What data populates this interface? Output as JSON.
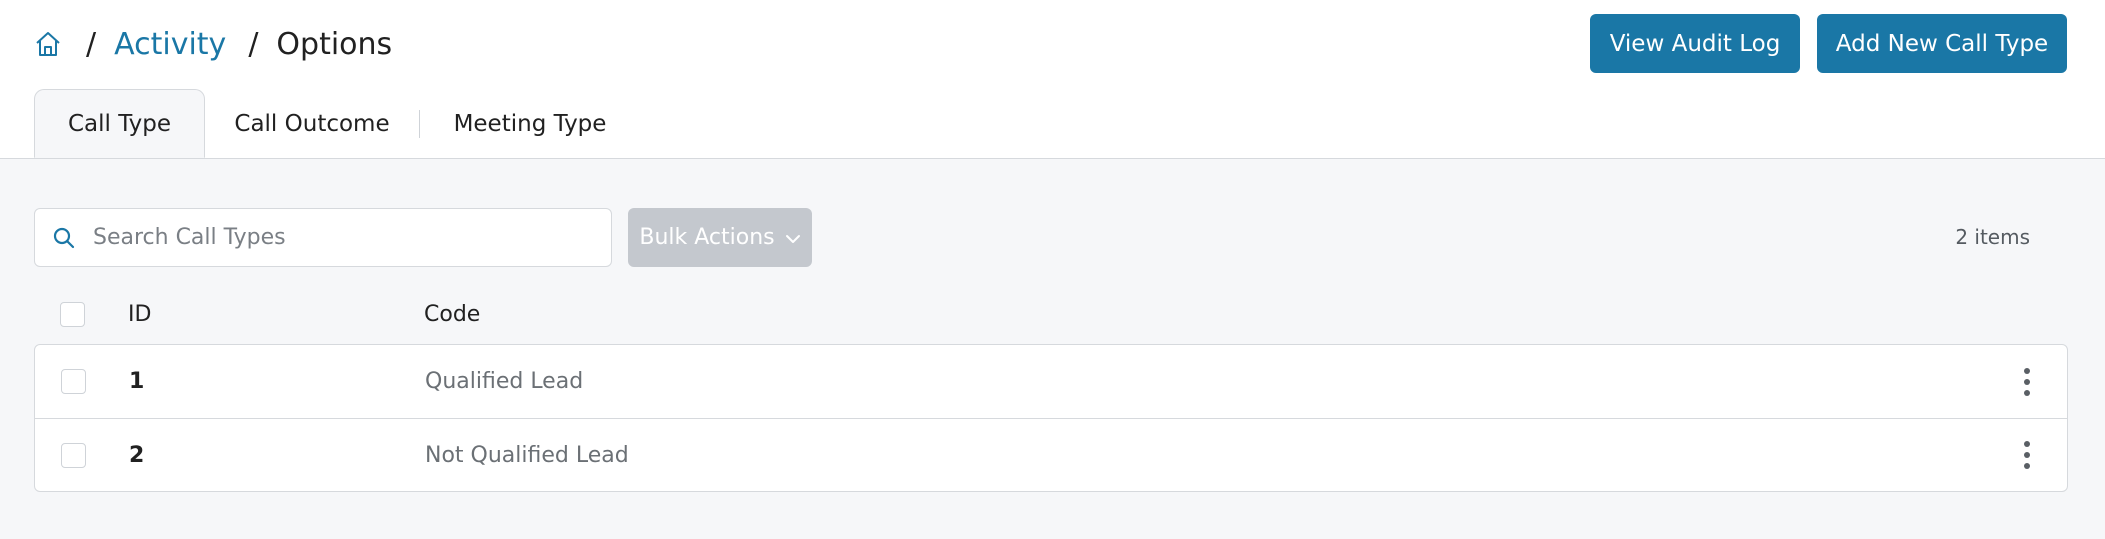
{
  "breadcrumb": {
    "home_icon": "home-icon",
    "sep": "/",
    "section": "Activity",
    "current": "Options"
  },
  "header": {
    "audit_label": "View Audit Log",
    "add_label": "Add New Call Type"
  },
  "tabs": [
    {
      "label": "Call Type",
      "active": true
    },
    {
      "label": "Call Outcome",
      "active": false
    },
    {
      "label": "Meeting Type",
      "active": false
    }
  ],
  "toolbar": {
    "search_placeholder": "Search Call Types",
    "bulk_label": "Bulk Actions",
    "item_count": "2 items"
  },
  "table": {
    "columns": [
      "ID",
      "Code"
    ],
    "rows": [
      {
        "id": "1",
        "code": "Qualified Lead"
      },
      {
        "id": "2",
        "code": "Not Qualified Lead"
      }
    ]
  },
  "colors": {
    "accent": "#1a77a6",
    "disabled_button": "#c4c8ce",
    "content_bg": "#f6f7f9"
  }
}
